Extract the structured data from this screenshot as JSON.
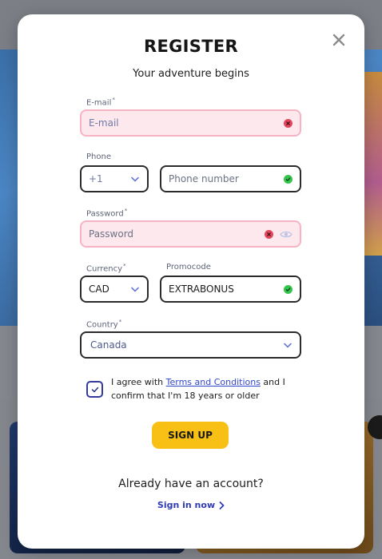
{
  "modal": {
    "title": "REGISTER",
    "subtitle": "Your adventure begins"
  },
  "form": {
    "email": {
      "label": "E-mail",
      "required_mark": "*",
      "placeholder": "E-mail",
      "status": "error"
    },
    "phone": {
      "label": "Phone",
      "code_value": "+1",
      "placeholder": "Phone number",
      "status": "valid"
    },
    "password": {
      "label": "Password",
      "required_mark": "*",
      "placeholder": "Password",
      "status": "error"
    },
    "currency": {
      "label": "Currency",
      "required_mark": "*",
      "value": "CAD"
    },
    "promocode": {
      "label": "Promocode",
      "value": "EXTRABONUS",
      "status": "valid"
    },
    "country": {
      "label": "Country",
      "required_mark": "*",
      "value": "Canada"
    }
  },
  "agreement": {
    "checked": true,
    "text_before": "I agree with ",
    "link_text": "Terms and Conditions",
    "text_after": " and I confirm that I'm 18 years or older"
  },
  "signup_label": "SIGN UP",
  "footer": {
    "prompt": "Already have an account?",
    "signin_label": "Sign in now"
  },
  "colors": {
    "primary_button": "#f8bf14",
    "error_border": "#f6b3c3",
    "error_fill": "#fde8ee",
    "valid_icon": "#35c44e",
    "error_icon": "#e2475f",
    "link": "#3046c8"
  },
  "icons": {
    "close": "close-icon",
    "valid": "check-circle-icon",
    "error": "x-circle-icon",
    "dropdown": "chevron-down-icon",
    "password_toggle": "eye-icon",
    "checkbox": "checkmark-icon",
    "signin_arrow": "chevron-right-icon"
  }
}
